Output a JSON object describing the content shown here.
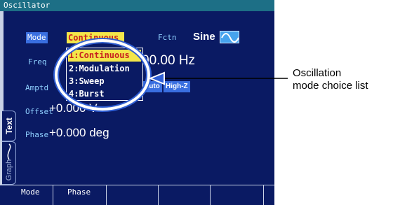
{
  "window": {
    "title": "Oscillator"
  },
  "params": {
    "mode": {
      "label": "Mode",
      "value": "Continuous"
    },
    "fctn": {
      "label": "Fctn",
      "value": "Sine",
      "icon": "sine-wave-icon"
    },
    "freq": {
      "label": "Freq",
      "value": "00.00 Hz"
    },
    "amptd": {
      "label": "Amptd",
      "chips": [
        "Auto",
        "High-Z"
      ]
    },
    "offset": {
      "label": "Offset",
      "value": "+0.000 V"
    },
    "phase": {
      "label": "Phase",
      "value": "+0.000 deg"
    }
  },
  "mode_list": {
    "options": [
      "1:Continuous",
      "2:Modulation",
      "3:Sweep",
      "4:Burst"
    ],
    "selected_index": 0
  },
  "side_tabs": {
    "text": "Text",
    "graph": "Graph"
  },
  "softkeys": [
    "Mode",
    "Phase",
    "",
    "",
    "",
    ""
  ],
  "annotation": {
    "line1": "Oscillation",
    "line2": "mode choice list"
  },
  "colors": {
    "screen_bg": "#0a1a63",
    "title_bg": "#1d6f86",
    "highlight": "#f3e64a",
    "highlight_text": "#c81f1f",
    "accent": "#3a6fe0",
    "callout": "#2f5fd6"
  }
}
